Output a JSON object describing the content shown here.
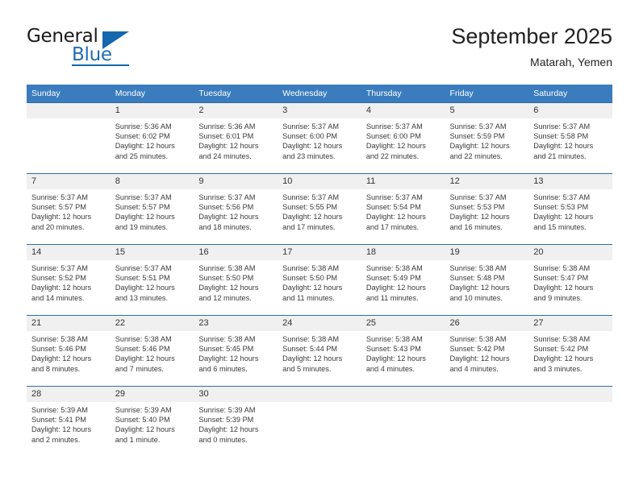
{
  "brand": {
    "line1": "General",
    "line2": "Blue",
    "accent_color": "#1567ae"
  },
  "header": {
    "title": "September 2025",
    "subtitle": "Matarah, Yemen"
  },
  "theme": {
    "header_row_bg": "#3a7cbe",
    "week_divider": "#2d6da4",
    "daynum_bg": "#f0f0f0"
  },
  "weekday_headers": [
    "Sunday",
    "Monday",
    "Tuesday",
    "Wednesday",
    "Thursday",
    "Friday",
    "Saturday"
  ],
  "weeks": [
    [
      {
        "day": "",
        "sunrise": "",
        "sunset": "",
        "daylight_line1": "",
        "daylight_line2": ""
      },
      {
        "day": "1",
        "sunrise": "Sunrise: 5:36 AM",
        "sunset": "Sunset: 6:02 PM",
        "daylight_line1": "Daylight: 12 hours",
        "daylight_line2": "and 25 minutes."
      },
      {
        "day": "2",
        "sunrise": "Sunrise: 5:36 AM",
        "sunset": "Sunset: 6:01 PM",
        "daylight_line1": "Daylight: 12 hours",
        "daylight_line2": "and 24 minutes."
      },
      {
        "day": "3",
        "sunrise": "Sunrise: 5:37 AM",
        "sunset": "Sunset: 6:00 PM",
        "daylight_line1": "Daylight: 12 hours",
        "daylight_line2": "and 23 minutes."
      },
      {
        "day": "4",
        "sunrise": "Sunrise: 5:37 AM",
        "sunset": "Sunset: 6:00 PM",
        "daylight_line1": "Daylight: 12 hours",
        "daylight_line2": "and 22 minutes."
      },
      {
        "day": "5",
        "sunrise": "Sunrise: 5:37 AM",
        "sunset": "Sunset: 5:59 PM",
        "daylight_line1": "Daylight: 12 hours",
        "daylight_line2": "and 22 minutes."
      },
      {
        "day": "6",
        "sunrise": "Sunrise: 5:37 AM",
        "sunset": "Sunset: 5:58 PM",
        "daylight_line1": "Daylight: 12 hours",
        "daylight_line2": "and 21 minutes."
      }
    ],
    [
      {
        "day": "7",
        "sunrise": "Sunrise: 5:37 AM",
        "sunset": "Sunset: 5:57 PM",
        "daylight_line1": "Daylight: 12 hours",
        "daylight_line2": "and 20 minutes."
      },
      {
        "day": "8",
        "sunrise": "Sunrise: 5:37 AM",
        "sunset": "Sunset: 5:57 PM",
        "daylight_line1": "Daylight: 12 hours",
        "daylight_line2": "and 19 minutes."
      },
      {
        "day": "9",
        "sunrise": "Sunrise: 5:37 AM",
        "sunset": "Sunset: 5:56 PM",
        "daylight_line1": "Daylight: 12 hours",
        "daylight_line2": "and 18 minutes."
      },
      {
        "day": "10",
        "sunrise": "Sunrise: 5:37 AM",
        "sunset": "Sunset: 5:55 PM",
        "daylight_line1": "Daylight: 12 hours",
        "daylight_line2": "and 17 minutes."
      },
      {
        "day": "11",
        "sunrise": "Sunrise: 5:37 AM",
        "sunset": "Sunset: 5:54 PM",
        "daylight_line1": "Daylight: 12 hours",
        "daylight_line2": "and 17 minutes."
      },
      {
        "day": "12",
        "sunrise": "Sunrise: 5:37 AM",
        "sunset": "Sunset: 5:53 PM",
        "daylight_line1": "Daylight: 12 hours",
        "daylight_line2": "and 16 minutes."
      },
      {
        "day": "13",
        "sunrise": "Sunrise: 5:37 AM",
        "sunset": "Sunset: 5:53 PM",
        "daylight_line1": "Daylight: 12 hours",
        "daylight_line2": "and 15 minutes."
      }
    ],
    [
      {
        "day": "14",
        "sunrise": "Sunrise: 5:37 AM",
        "sunset": "Sunset: 5:52 PM",
        "daylight_line1": "Daylight: 12 hours",
        "daylight_line2": "and 14 minutes."
      },
      {
        "day": "15",
        "sunrise": "Sunrise: 5:37 AM",
        "sunset": "Sunset: 5:51 PM",
        "daylight_line1": "Daylight: 12 hours",
        "daylight_line2": "and 13 minutes."
      },
      {
        "day": "16",
        "sunrise": "Sunrise: 5:38 AM",
        "sunset": "Sunset: 5:50 PM",
        "daylight_line1": "Daylight: 12 hours",
        "daylight_line2": "and 12 minutes."
      },
      {
        "day": "17",
        "sunrise": "Sunrise: 5:38 AM",
        "sunset": "Sunset: 5:50 PM",
        "daylight_line1": "Daylight: 12 hours",
        "daylight_line2": "and 11 minutes."
      },
      {
        "day": "18",
        "sunrise": "Sunrise: 5:38 AM",
        "sunset": "Sunset: 5:49 PM",
        "daylight_line1": "Daylight: 12 hours",
        "daylight_line2": "and 11 minutes."
      },
      {
        "day": "19",
        "sunrise": "Sunrise: 5:38 AM",
        "sunset": "Sunset: 5:48 PM",
        "daylight_line1": "Daylight: 12 hours",
        "daylight_line2": "and 10 minutes."
      },
      {
        "day": "20",
        "sunrise": "Sunrise: 5:38 AM",
        "sunset": "Sunset: 5:47 PM",
        "daylight_line1": "Daylight: 12 hours",
        "daylight_line2": "and 9 minutes."
      }
    ],
    [
      {
        "day": "21",
        "sunrise": "Sunrise: 5:38 AM",
        "sunset": "Sunset: 5:46 PM",
        "daylight_line1": "Daylight: 12 hours",
        "daylight_line2": "and 8 minutes."
      },
      {
        "day": "22",
        "sunrise": "Sunrise: 5:38 AM",
        "sunset": "Sunset: 5:46 PM",
        "daylight_line1": "Daylight: 12 hours",
        "daylight_line2": "and 7 minutes."
      },
      {
        "day": "23",
        "sunrise": "Sunrise: 5:38 AM",
        "sunset": "Sunset: 5:45 PM",
        "daylight_line1": "Daylight: 12 hours",
        "daylight_line2": "and 6 minutes."
      },
      {
        "day": "24",
        "sunrise": "Sunrise: 5:38 AM",
        "sunset": "Sunset: 5:44 PM",
        "daylight_line1": "Daylight: 12 hours",
        "daylight_line2": "and 5 minutes."
      },
      {
        "day": "25",
        "sunrise": "Sunrise: 5:38 AM",
        "sunset": "Sunset: 5:43 PM",
        "daylight_line1": "Daylight: 12 hours",
        "daylight_line2": "and 4 minutes."
      },
      {
        "day": "26",
        "sunrise": "Sunrise: 5:38 AM",
        "sunset": "Sunset: 5:42 PM",
        "daylight_line1": "Daylight: 12 hours",
        "daylight_line2": "and 4 minutes."
      },
      {
        "day": "27",
        "sunrise": "Sunrise: 5:38 AM",
        "sunset": "Sunset: 5:42 PM",
        "daylight_line1": "Daylight: 12 hours",
        "daylight_line2": "and 3 minutes."
      }
    ],
    [
      {
        "day": "28",
        "sunrise": "Sunrise: 5:39 AM",
        "sunset": "Sunset: 5:41 PM",
        "daylight_line1": "Daylight: 12 hours",
        "daylight_line2": "and 2 minutes."
      },
      {
        "day": "29",
        "sunrise": "Sunrise: 5:39 AM",
        "sunset": "Sunset: 5:40 PM",
        "daylight_line1": "Daylight: 12 hours",
        "daylight_line2": "and 1 minute."
      },
      {
        "day": "30",
        "sunrise": "Sunrise: 5:39 AM",
        "sunset": "Sunset: 5:39 PM",
        "daylight_line1": "Daylight: 12 hours",
        "daylight_line2": "and 0 minutes."
      },
      {
        "day": "",
        "sunrise": "",
        "sunset": "",
        "daylight_line1": "",
        "daylight_line2": ""
      },
      {
        "day": "",
        "sunrise": "",
        "sunset": "",
        "daylight_line1": "",
        "daylight_line2": ""
      },
      {
        "day": "",
        "sunrise": "",
        "sunset": "",
        "daylight_line1": "",
        "daylight_line2": ""
      },
      {
        "day": "",
        "sunrise": "",
        "sunset": "",
        "daylight_line1": "",
        "daylight_line2": ""
      }
    ]
  ]
}
